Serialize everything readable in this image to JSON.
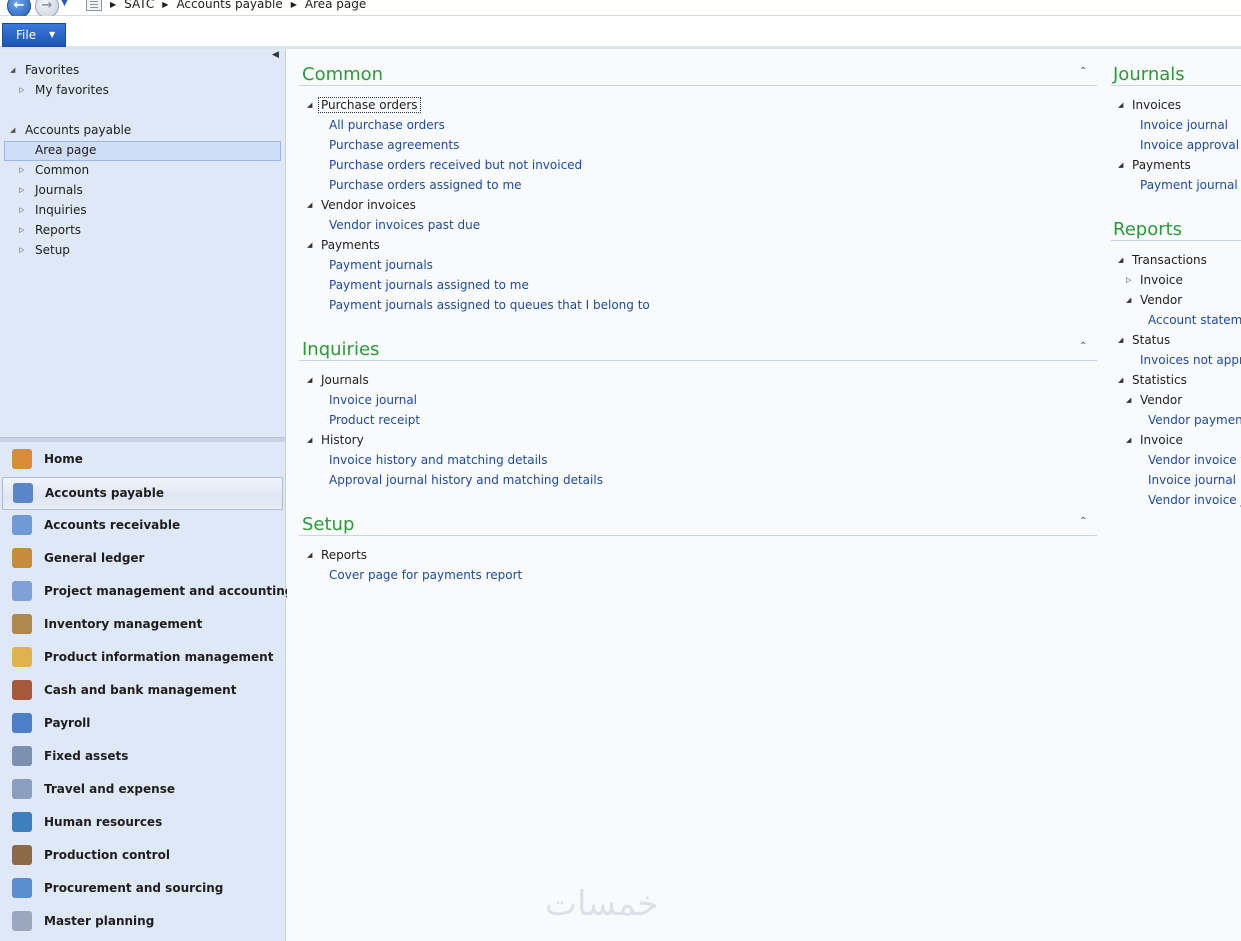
{
  "breadcrumb": [
    "SATC",
    "Accounts payable",
    "Area page"
  ],
  "ribbon": {
    "file_label": "File"
  },
  "nav_tree": {
    "favorites": "Favorites",
    "my_favorites": "My favorites",
    "module": "Accounts payable",
    "items": [
      "Area page",
      "Common",
      "Journals",
      "Inquiries",
      "Reports",
      "Setup"
    ]
  },
  "modules": [
    {
      "label": "Home",
      "color": "#d98a3a"
    },
    {
      "label": "Accounts payable",
      "color": "#5a86c9"
    },
    {
      "label": "Accounts receivable",
      "color": "#6f9ad6"
    },
    {
      "label": "General ledger",
      "color": "#c78b3c"
    },
    {
      "label": "Project management and accounting",
      "color": "#7fa1d6"
    },
    {
      "label": "Inventory management",
      "color": "#b0884e"
    },
    {
      "label": "Product information management",
      "color": "#e0b24e"
    },
    {
      "label": "Cash and bank management",
      "color": "#a5593a"
    },
    {
      "label": "Payroll",
      "color": "#4d7fc9"
    },
    {
      "label": "Fixed assets",
      "color": "#7b8fb0"
    },
    {
      "label": "Travel and expense",
      "color": "#8a9fbf"
    },
    {
      "label": "Human resources",
      "color": "#3f7fbf"
    },
    {
      "label": "Production control",
      "color": "#8c6a48"
    },
    {
      "label": "Procurement and sourcing",
      "color": "#5b8ed1"
    },
    {
      "label": "Master planning",
      "color": "#9aa7bd"
    }
  ],
  "common": {
    "title": "Common",
    "purchase_orders": {
      "label": "Purchase orders",
      "links": [
        "All purchase orders",
        "Purchase agreements",
        "Purchase orders received but not invoiced",
        "Purchase orders assigned to me"
      ]
    },
    "vendor_invoices": {
      "label": "Vendor invoices",
      "links": [
        "Vendor invoices past due"
      ]
    },
    "payments": {
      "label": "Payments",
      "links": [
        "Payment journals",
        "Payment journals assigned to me",
        "Payment journals assigned to queues that I belong to"
      ]
    }
  },
  "inquiries": {
    "title": "Inquiries",
    "journals": {
      "label": "Journals",
      "links": [
        "Invoice journal",
        "Product receipt"
      ]
    },
    "history": {
      "label": "History",
      "links": [
        "Invoice history and matching details",
        "Approval journal history and matching details"
      ]
    }
  },
  "setup": {
    "title": "Setup",
    "reports": {
      "label": "Reports",
      "links": [
        "Cover page for payments report"
      ]
    }
  },
  "journals": {
    "title": "Journals",
    "invoices": {
      "label": "Invoices",
      "links": [
        "Invoice journal",
        "Invoice approval jo"
      ]
    },
    "payments": {
      "label": "Payments",
      "links": [
        "Payment journal"
      ]
    }
  },
  "reports": {
    "title": "Reports",
    "transactions": "Transactions",
    "invoice": "Invoice",
    "vendor": "Vendor",
    "account_statement": "Account statemer",
    "status": "Status",
    "invoices_not_approved": "Invoices not approv",
    "statistics": "Statistics",
    "stat_vendor": "Vendor",
    "vendor_payment": "Vendor payment j",
    "stat_invoice": "Invoice",
    "vendor_invoice_tu": "Vendor invoice tu",
    "invoice_journal": "Invoice journal",
    "vendor_invoice_jo": "Vendor invoice jo"
  },
  "watermark": "خمسات"
}
